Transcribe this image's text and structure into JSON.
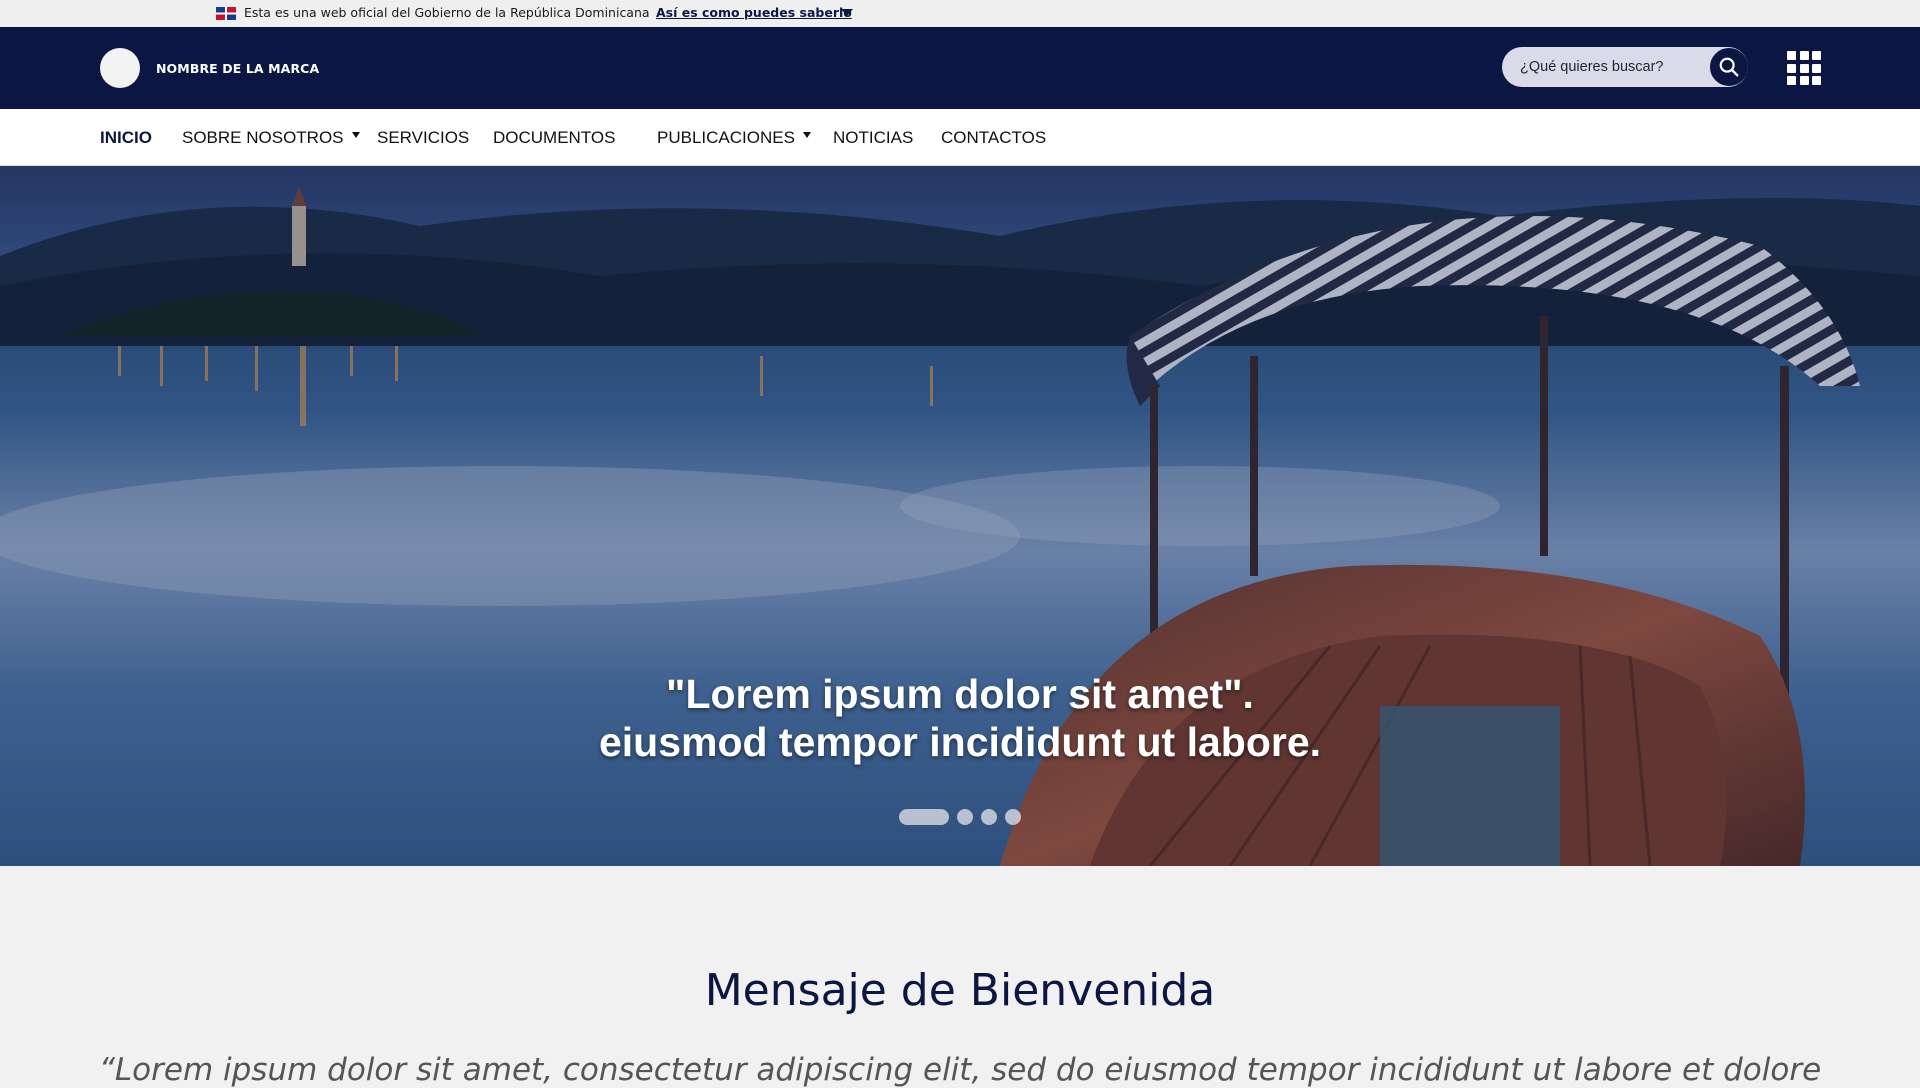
{
  "gov_bar": {
    "text": "Esta es una web oficial del Gobierno de la República Dominicana",
    "link": "Así es como puedes saberlo"
  },
  "header": {
    "brand_name": "NOMBRE DE LA MARCA",
    "search_placeholder": "¿Qué quieres buscar?",
    "colors": {
      "primary": "#0c1642",
      "search_bg": "#d9dce8"
    }
  },
  "nav": {
    "items": [
      {
        "label": "INICIO",
        "active": true,
        "dropdown": false
      },
      {
        "label": "SOBRE NOSOTROS",
        "active": false,
        "dropdown": true
      },
      {
        "label": "SERVICIOS",
        "active": false,
        "dropdown": false
      },
      {
        "label": "DOCUMENTOS",
        "active": false,
        "dropdown": false
      },
      {
        "label": "PUBLICACIONES",
        "active": false,
        "dropdown": true
      },
      {
        "label": "NOTICIAS",
        "active": false,
        "dropdown": false
      },
      {
        "label": "CONTACTOS",
        "active": false,
        "dropdown": false
      }
    ]
  },
  "hero": {
    "caption_line1": "\"Lorem ipsum dolor sit amet\".",
    "caption_line2": "eiusmod tempor incididunt ut labore.",
    "slides_count": 4,
    "active_slide": 1
  },
  "welcome": {
    "title": "Mensaje de Bienvenida",
    "quote": "“Lorem ipsum dolor sit amet, consectetur adipiscing elit, sed do eiusmod tempor incididunt ut labore et dolore"
  },
  "icons": {
    "flag": "dominican-flag-icon",
    "caret": "caret-down-icon",
    "search": "search-icon",
    "apps": "apps-grid-icon"
  }
}
